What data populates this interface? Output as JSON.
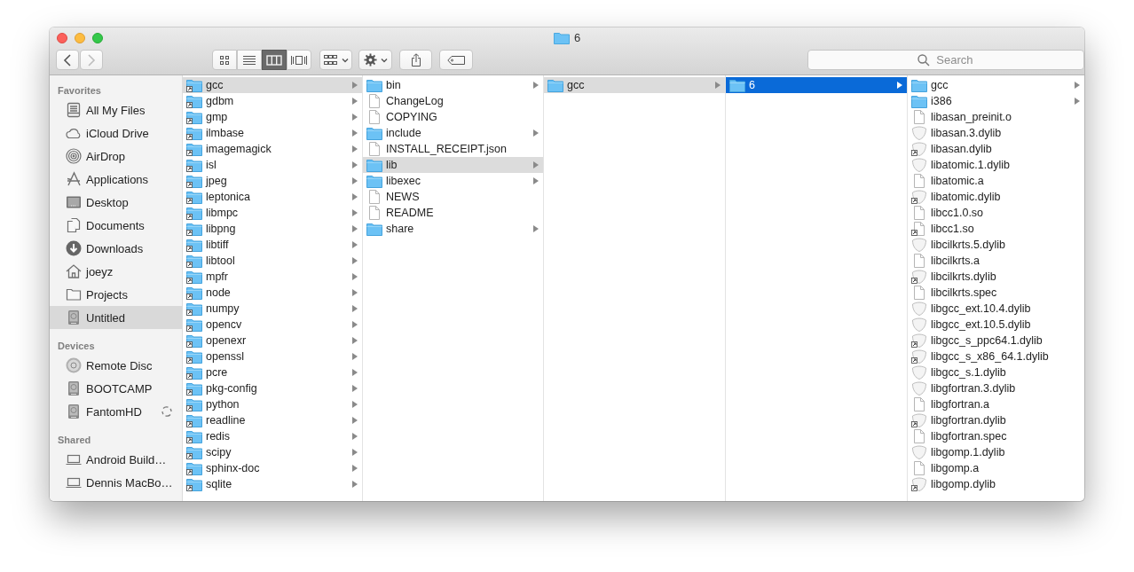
{
  "window": {
    "title": "6"
  },
  "toolbar": {
    "back": {
      "disabled": false
    },
    "forward": {
      "disabled": true
    },
    "views": [
      {
        "kind": "icons",
        "selected": false
      },
      {
        "kind": "list",
        "selected": false
      },
      {
        "kind": "columns",
        "selected": true
      },
      {
        "kind": "coverflow",
        "selected": false
      }
    ],
    "search": {
      "placeholder": "Search"
    }
  },
  "sidebar": {
    "sections": [
      {
        "title": "Favorites",
        "items": [
          {
            "label": "All My Files",
            "kind": "files",
            "selected": false,
            "syncing": false
          },
          {
            "label": "iCloud Drive",
            "kind": "cloud",
            "selected": false,
            "syncing": false
          },
          {
            "label": "AirDrop",
            "kind": "airdrop",
            "selected": false,
            "syncing": false
          },
          {
            "label": "Applications",
            "kind": "apps",
            "selected": false,
            "syncing": false
          },
          {
            "label": "Desktop",
            "kind": "desktop",
            "selected": false,
            "syncing": false
          },
          {
            "label": "Documents",
            "kind": "documents",
            "selected": false,
            "syncing": false
          },
          {
            "label": "Downloads",
            "kind": "downloads",
            "selected": false,
            "syncing": false
          },
          {
            "label": "joeyz",
            "kind": "home",
            "selected": false,
            "syncing": false
          },
          {
            "label": "Projects",
            "kind": "folder",
            "selected": false,
            "syncing": false
          },
          {
            "label": "Untitled",
            "kind": "disk",
            "selected": true,
            "syncing": false
          }
        ]
      },
      {
        "title": "Devices",
        "items": [
          {
            "label": "Remote Disc",
            "kind": "disc",
            "selected": false,
            "syncing": false
          },
          {
            "label": "BOOTCAMP",
            "kind": "disk",
            "selected": false,
            "syncing": false
          },
          {
            "label": "FantomHD",
            "kind": "disk",
            "selected": false,
            "syncing": true
          }
        ]
      },
      {
        "title": "Shared",
        "items": [
          {
            "label": "Android Build…",
            "kind": "computer",
            "selected": false,
            "syncing": false
          },
          {
            "label": "Dennis MacBo…",
            "kind": "computer",
            "selected": false,
            "syncing": false
          }
        ]
      }
    ]
  },
  "columns": [
    {
      "items": [
        {
          "name": "gcc",
          "kind": "folder",
          "alias": true,
          "selected": true
        },
        {
          "name": "gdbm",
          "kind": "folder",
          "alias": true,
          "selected": false
        },
        {
          "name": "gmp",
          "kind": "folder",
          "alias": true,
          "selected": false
        },
        {
          "name": "ilmbase",
          "kind": "folder",
          "alias": true,
          "selected": false
        },
        {
          "name": "imagemagick",
          "kind": "folder",
          "alias": true,
          "selected": false
        },
        {
          "name": "isl",
          "kind": "folder",
          "alias": true,
          "selected": false
        },
        {
          "name": "jpeg",
          "kind": "folder",
          "alias": true,
          "selected": false
        },
        {
          "name": "leptonica",
          "kind": "folder",
          "alias": true,
          "selected": false
        },
        {
          "name": "libmpc",
          "kind": "folder",
          "alias": true,
          "selected": false
        },
        {
          "name": "libpng",
          "kind": "folder",
          "alias": true,
          "selected": false
        },
        {
          "name": "libtiff",
          "kind": "folder",
          "alias": true,
          "selected": false
        },
        {
          "name": "libtool",
          "kind": "folder",
          "alias": true,
          "selected": false
        },
        {
          "name": "mpfr",
          "kind": "folder",
          "alias": true,
          "selected": false
        },
        {
          "name": "node",
          "kind": "folder",
          "alias": true,
          "selected": false
        },
        {
          "name": "numpy",
          "kind": "folder",
          "alias": true,
          "selected": false
        },
        {
          "name": "opencv",
          "kind": "folder",
          "alias": true,
          "selected": false
        },
        {
          "name": "openexr",
          "kind": "folder",
          "alias": true,
          "selected": false
        },
        {
          "name": "openssl",
          "kind": "folder",
          "alias": true,
          "selected": false
        },
        {
          "name": "pcre",
          "kind": "folder",
          "alias": true,
          "selected": false
        },
        {
          "name": "pkg-config",
          "kind": "folder",
          "alias": true,
          "selected": false
        },
        {
          "name": "python",
          "kind": "folder",
          "alias": true,
          "selected": false
        },
        {
          "name": "readline",
          "kind": "folder",
          "alias": true,
          "selected": false
        },
        {
          "name": "redis",
          "kind": "folder",
          "alias": true,
          "selected": false
        },
        {
          "name": "scipy",
          "kind": "folder",
          "alias": true,
          "selected": false
        },
        {
          "name": "sphinx-doc",
          "kind": "folder",
          "alias": true,
          "selected": false
        },
        {
          "name": "sqlite",
          "kind": "folder",
          "alias": true,
          "selected": false
        }
      ]
    },
    {
      "items": [
        {
          "name": "bin",
          "kind": "folder",
          "alias": false,
          "selected": false
        },
        {
          "name": "ChangeLog",
          "kind": "file",
          "alias": false,
          "selected": false
        },
        {
          "name": "COPYING",
          "kind": "file",
          "alias": false,
          "selected": false
        },
        {
          "name": "include",
          "kind": "folder",
          "alias": false,
          "selected": false
        },
        {
          "name": "INSTALL_RECEIPT.json",
          "kind": "file",
          "alias": false,
          "selected": false
        },
        {
          "name": "lib",
          "kind": "folder",
          "alias": false,
          "selected": true
        },
        {
          "name": "libexec",
          "kind": "folder",
          "alias": false,
          "selected": false
        },
        {
          "name": "NEWS",
          "kind": "file",
          "alias": false,
          "selected": false
        },
        {
          "name": "README",
          "kind": "file",
          "alias": false,
          "selected": false
        },
        {
          "name": "share",
          "kind": "folder",
          "alias": false,
          "selected": false
        }
      ]
    },
    {
      "items": [
        {
          "name": "gcc",
          "kind": "folder",
          "alias": false,
          "selected": true
        }
      ]
    },
    {
      "items": [
        {
          "name": "6",
          "kind": "folder",
          "alias": false,
          "selected": true,
          "focused": true
        }
      ]
    },
    {
      "items": [
        {
          "name": "gcc",
          "kind": "folder",
          "alias": false,
          "selected": false
        },
        {
          "name": "i386",
          "kind": "folder",
          "alias": false,
          "selected": false
        },
        {
          "name": "libasan_preinit.o",
          "kind": "file",
          "alias": false,
          "selected": false
        },
        {
          "name": "libasan.3.dylib",
          "kind": "library",
          "alias": false,
          "selected": false
        },
        {
          "name": "libasan.dylib",
          "kind": "library",
          "alias": true,
          "selected": false
        },
        {
          "name": "libatomic.1.dylib",
          "kind": "library",
          "alias": false,
          "selected": false
        },
        {
          "name": "libatomic.a",
          "kind": "file",
          "alias": false,
          "selected": false
        },
        {
          "name": "libatomic.dylib",
          "kind": "library",
          "alias": true,
          "selected": false
        },
        {
          "name": "libcc1.0.so",
          "kind": "file",
          "alias": false,
          "selected": false
        },
        {
          "name": "libcc1.so",
          "kind": "file",
          "alias": true,
          "selected": false
        },
        {
          "name": "libcilkrts.5.dylib",
          "kind": "library",
          "alias": false,
          "selected": false
        },
        {
          "name": "libcilkrts.a",
          "kind": "file",
          "alias": false,
          "selected": false
        },
        {
          "name": "libcilkrts.dylib",
          "kind": "library",
          "alias": true,
          "selected": false
        },
        {
          "name": "libcilkrts.spec",
          "kind": "file",
          "alias": false,
          "selected": false
        },
        {
          "name": "libgcc_ext.10.4.dylib",
          "kind": "library",
          "alias": false,
          "selected": false
        },
        {
          "name": "libgcc_ext.10.5.dylib",
          "kind": "library",
          "alias": false,
          "selected": false
        },
        {
          "name": "libgcc_s_ppc64.1.dylib",
          "kind": "library",
          "alias": true,
          "selected": false
        },
        {
          "name": "libgcc_s_x86_64.1.dylib",
          "kind": "library",
          "alias": true,
          "selected": false
        },
        {
          "name": "libgcc_s.1.dylib",
          "kind": "library",
          "alias": false,
          "selected": false
        },
        {
          "name": "libgfortran.3.dylib",
          "kind": "library",
          "alias": false,
          "selected": false
        },
        {
          "name": "libgfortran.a",
          "kind": "file",
          "alias": false,
          "selected": false
        },
        {
          "name": "libgfortran.dylib",
          "kind": "library",
          "alias": true,
          "selected": false
        },
        {
          "name": "libgfortran.spec",
          "kind": "file",
          "alias": false,
          "selected": false
        },
        {
          "name": "libgomp.1.dylib",
          "kind": "library",
          "alias": false,
          "selected": false
        },
        {
          "name": "libgomp.a",
          "kind": "file",
          "alias": false,
          "selected": false
        },
        {
          "name": "libgomp.dylib",
          "kind": "library",
          "alias": true,
          "selected": false
        }
      ]
    }
  ]
}
